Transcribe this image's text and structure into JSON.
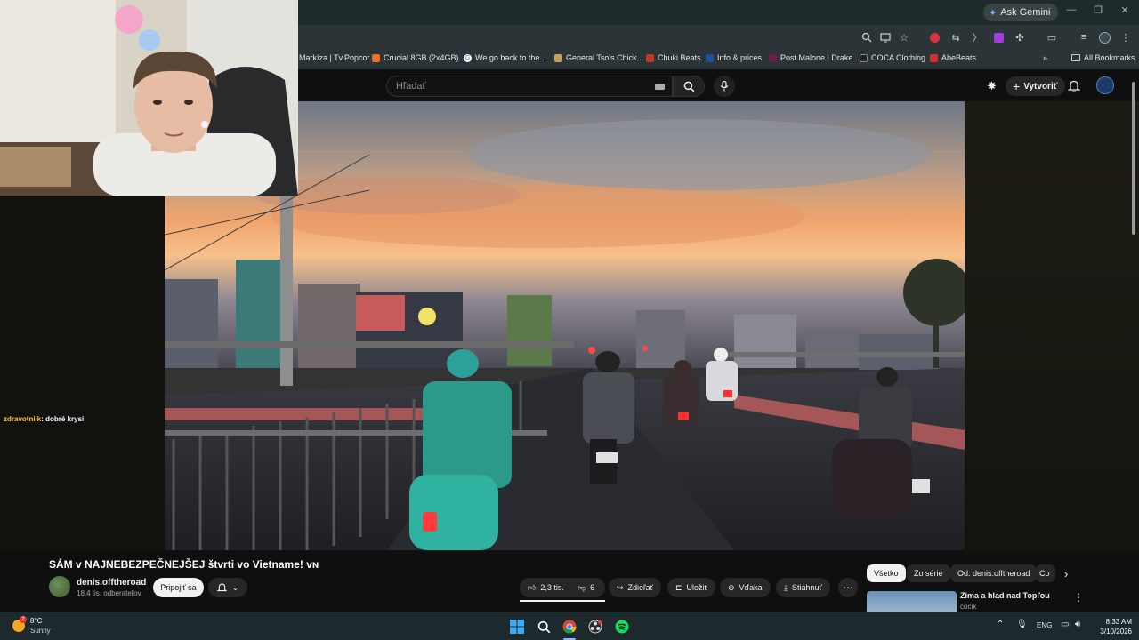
{
  "browser": {
    "ask_gemini": "Ask Gemini",
    "bookmarks": [
      {
        "label": "Markíza | Tv.Popcor...",
        "color": "#1a1a1a"
      },
      {
        "label": "Crucial 8GB (2x4GB)...",
        "color": "#e8702a"
      },
      {
        "label": "We go back to the...",
        "color": "#4285f4"
      },
      {
        "label": "General Tso's Chick...",
        "color": "#c8a060"
      },
      {
        "label": "Chuki Beats",
        "color": "#c0392b"
      },
      {
        "label": "Info & prices",
        "color": "#1e4fa3"
      },
      {
        "label": "Post Malone | Drake...",
        "color": "#6b1f4a"
      },
      {
        "label": "COCA Clothing",
        "color": "#222222"
      },
      {
        "label": "AbeBeats",
        "color": "#d32f2f"
      }
    ],
    "all_bookmarks": "All Bookmarks"
  },
  "masthead": {
    "search_placeholder": "Hľadať",
    "create_label": "Vytvoriť"
  },
  "chat": {
    "user": "zdravotniik",
    "message": ": dobré krysi"
  },
  "video": {
    "title": "SÁM v NAJNEBEZPEČNEJŠEJ štvrti vo Vietname! ᴠɴ",
    "channel": "denis.offtheroad",
    "subscribers": "18,4 tis. odberateľov",
    "join_label": "Pripojiť sa",
    "likes": "2,3 tis.",
    "dislikes": "6",
    "share_label": "Zdieľať",
    "save_label": "Uložiť",
    "thanks_label": "Vďaka",
    "download_label": "Stiahnuť"
  },
  "chips": [
    "Všetko",
    "Zo série",
    "Od: denis.offtheroad",
    "Co"
  ],
  "recommendation": {
    "title": "Zima a hlad nad Topľou",
    "channel": "cocik"
  },
  "taskbar": {
    "temperature": "8°C",
    "condition": "Sunny",
    "weather_badge": "2",
    "language": "ENG",
    "time": "8:33 AM",
    "date": "3/10/2026"
  }
}
